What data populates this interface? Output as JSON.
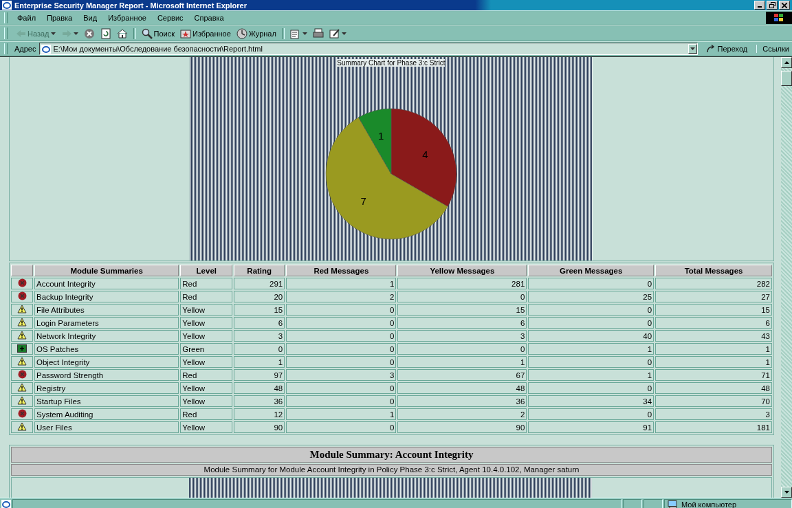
{
  "window": {
    "title": "Enterprise Security Manager Report - Microsoft Internet Explorer"
  },
  "menu": [
    "Файл",
    "Правка",
    "Вид",
    "Избранное",
    "Сервис",
    "Справка"
  ],
  "toolbar": [
    {
      "kind": "back",
      "label": "Назад",
      "disabled": true,
      "dropdown": true
    },
    {
      "kind": "forward",
      "disabled": true,
      "dropdown": true
    },
    {
      "kind": "stop",
      "disabled": false
    },
    {
      "kind": "refresh",
      "disabled": false
    },
    {
      "kind": "home",
      "disabled": false
    },
    {
      "kind": "search",
      "label": "Поиск",
      "disabled": false,
      "separator": true
    },
    {
      "kind": "favorites",
      "label": "Избранное",
      "disabled": false
    },
    {
      "kind": "history",
      "label": "Журнал",
      "disabled": false
    },
    {
      "kind": "mail",
      "disabled": false,
      "dropdown": true,
      "separator": true
    },
    {
      "kind": "print",
      "disabled": false
    },
    {
      "kind": "edit",
      "disabled": false,
      "dropdown": true
    }
  ],
  "address": {
    "label": "Адрес",
    "value": "E:\\Мои документы\\Обследование безопасности\\Report.html",
    "go": "Переход",
    "links": "Ссылки"
  },
  "chart": {
    "chart_data": {
      "type": "pie",
      "title": "Summary Chart for Phase 3:c Strict",
      "values": [
        4,
        7,
        1
      ],
      "colors": [
        "#8a1a1a",
        "#9a9a20",
        "#1a8a2a"
      ],
      "value_labels": [
        "4",
        "7",
        "1"
      ]
    }
  },
  "table": {
    "columns": [
      "Module Summaries",
      "Level",
      "Rating",
      "Red Messages",
      "Yellow Messages",
      "Green Messages",
      "Total Messages"
    ],
    "rows": [
      {
        "kind": "error",
        "cells": [
          "Account Integrity",
          "Red",
          "291",
          "1",
          "281",
          "0",
          "282"
        ]
      },
      {
        "kind": "error",
        "cells": [
          "Backup Integrity",
          "Red",
          "20",
          "2",
          "0",
          "25",
          "27"
        ]
      },
      {
        "kind": "warning",
        "cells": [
          "File Attributes",
          "Yellow",
          "15",
          "0",
          "15",
          "0",
          "15"
        ]
      },
      {
        "kind": "warning",
        "cells": [
          "Login Parameters",
          "Yellow",
          "6",
          "0",
          "6",
          "0",
          "6"
        ]
      },
      {
        "kind": "warning",
        "cells": [
          "Network Integrity",
          "Yellow",
          "3",
          "0",
          "3",
          "40",
          "43"
        ]
      },
      {
        "kind": "ok",
        "cells": [
          "OS Patches",
          "Green",
          "0",
          "0",
          "0",
          "1",
          "1"
        ]
      },
      {
        "kind": "warning",
        "cells": [
          "Object Integrity",
          "Yellow",
          "1",
          "0",
          "1",
          "0",
          "1"
        ]
      },
      {
        "kind": "error",
        "cells": [
          "Password Strength",
          "Red",
          "97",
          "3",
          "67",
          "1",
          "71"
        ]
      },
      {
        "kind": "warning",
        "cells": [
          "Registry",
          "Yellow",
          "48",
          "0",
          "48",
          "0",
          "48"
        ]
      },
      {
        "kind": "warning",
        "cells": [
          "Startup Files",
          "Yellow",
          "36",
          "0",
          "36",
          "34",
          "70"
        ]
      },
      {
        "kind": "error",
        "cells": [
          "System Auditing",
          "Red",
          "12",
          "1",
          "2",
          "0",
          "3"
        ]
      },
      {
        "kind": "warning",
        "cells": [
          "User Files",
          "Yellow",
          "90",
          "0",
          "90",
          "91",
          "181"
        ]
      }
    ]
  },
  "section": {
    "heading": "Module Summary: Account Integrity",
    "subtitle": "Module Summary for Module Account Integrity in Policy Phase 3:c Strict, Agent 10.4.0.102, Manager saturn"
  },
  "status_bar": {
    "zone": "Мой компьютер"
  }
}
